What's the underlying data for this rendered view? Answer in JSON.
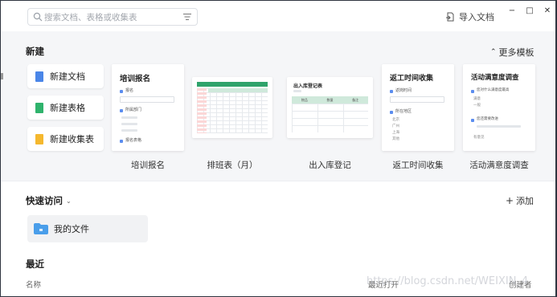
{
  "search": {
    "placeholder": "搜索文档、表格或收集表"
  },
  "toolbar": {
    "import_label": "导入文档"
  },
  "window": {
    "minimize": "−",
    "maximize": "□",
    "close": "✕"
  },
  "new_section": {
    "title": "新建",
    "more_label": "更多模板",
    "buttons": [
      {
        "label": "新建文档",
        "icon": "doc-icon",
        "color": "#4a86e8"
      },
      {
        "label": "新建表格",
        "icon": "sheet-icon",
        "color": "#2fb36c"
      },
      {
        "label": "新建收集表",
        "icon": "form-icon",
        "color": "#f5b82e"
      }
    ],
    "templates": [
      {
        "label": "培训报名",
        "card_title": "培训报名",
        "rows": [
          "报名",
          "所属部门",
          "报名表格"
        ]
      },
      {
        "label": "排班表（月）",
        "card_title": ""
      },
      {
        "label": "出入库登记",
        "card_title": "出入库登记表",
        "headers": [
          "物品",
          "数量",
          "备注"
        ]
      },
      {
        "label": "返工时间收集",
        "card_title": "返工时间收集",
        "rows": [
          "返岗时间",
          "所在地区",
          "北京",
          "广州",
          "上海",
          "其他"
        ]
      },
      {
        "label": "活动满意度调查",
        "card_title": "活动满意度调查",
        "rows": [
          "您对什么满意度最高",
          "满意",
          "一般",
          "您还需要改进",
          "有意见"
        ]
      }
    ]
  },
  "quick_access": {
    "title": "快速访问",
    "add_label": "添加",
    "folders": [
      {
        "label": "我的文件"
      }
    ]
  },
  "recent": {
    "title": "最近",
    "columns": {
      "name": "名称",
      "opened": "最近打开",
      "creator": "创建者"
    }
  },
  "watermark": "https://blog.csdn.net/WEIXIN_4"
}
